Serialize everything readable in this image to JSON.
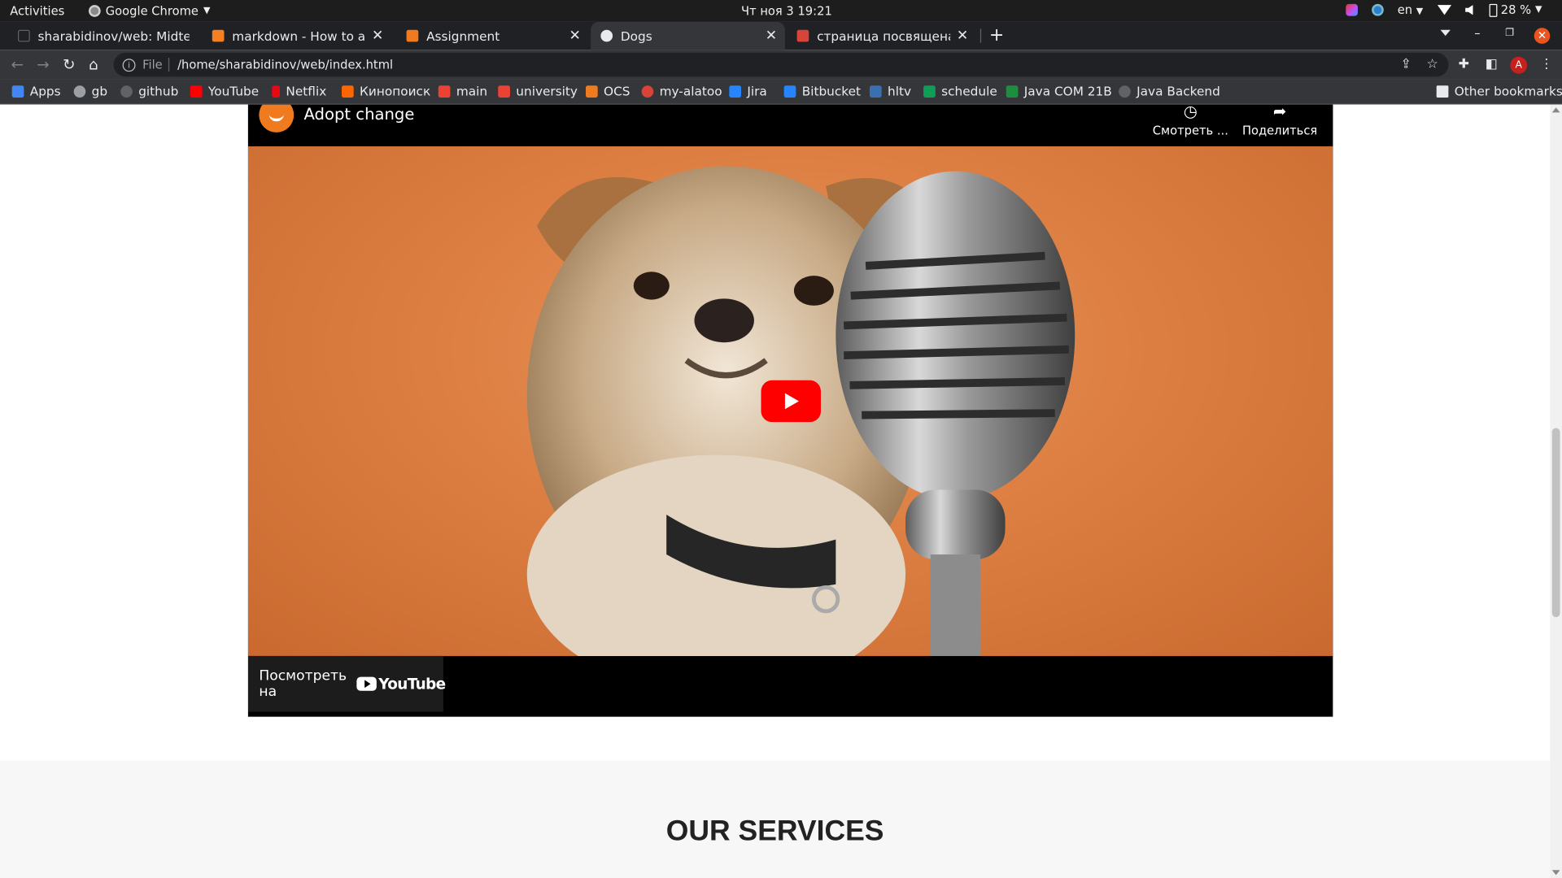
{
  "system_bar": {
    "activities": "Activities",
    "app_name": "Google Chrome",
    "clock": "Чт ноя 3  19:21",
    "keyboard_layout": "en",
    "battery": "28 %"
  },
  "tabs": [
    {
      "title": "sharabidinov/web: Midte",
      "favicon_color": "#202124",
      "active": false
    },
    {
      "title": "markdown - How to add in",
      "favicon_color": "#f48024",
      "active": false
    },
    {
      "title": "Assignment",
      "favicon_color": "#f07b1f",
      "active": false
    },
    {
      "title": "Dogs",
      "favicon_color": "#e8eaed",
      "active": true
    },
    {
      "title": "страница посвящена соб",
      "favicon_color": "#d9443a",
      "active": false
    }
  ],
  "toolbar": {
    "scheme": "File",
    "url": "/home/sharabidinov/web/index.html",
    "avatar_letter": "A"
  },
  "bookmarks": [
    {
      "label": "Apps",
      "icon": "apps-grid-icon",
      "color": "#4285f4"
    },
    {
      "label": "gb",
      "icon": "gb-icon",
      "color": "#9aa0a6"
    },
    {
      "label": "github",
      "icon": "github-icon",
      "color": "#5f6368"
    },
    {
      "label": "YouTube",
      "icon": "youtube-icon",
      "color": "#ff0000"
    },
    {
      "label": "Netflix",
      "icon": "netflix-icon",
      "color": "#e50914"
    },
    {
      "label": "Кинопоиск",
      "icon": "kinopoisk-icon",
      "color": "#ff6600"
    },
    {
      "label": "main",
      "icon": "gmail-icon",
      "color": "#ea4335"
    },
    {
      "label": "university",
      "icon": "gmail-icon",
      "color": "#ea4335"
    },
    {
      "label": "OCS",
      "icon": "ocs-icon",
      "color": "#f07b1f"
    },
    {
      "label": "my-alatoo",
      "icon": "alatoo-icon",
      "color": "#d9443a"
    },
    {
      "label": "Jira",
      "icon": "jira-icon",
      "color": "#2684ff"
    },
    {
      "label": "Bitbucket",
      "icon": "bitbucket-icon",
      "color": "#2684ff"
    },
    {
      "label": "hltv",
      "icon": "hltv-icon",
      "color": "#3a6fb0"
    },
    {
      "label": "schedule",
      "icon": "sheets-icon",
      "color": "#0f9d58"
    },
    {
      "label": "Java COM 21B",
      "icon": "classroom-icon",
      "color": "#1e8e3e"
    },
    {
      "label": "Java Backend",
      "icon": "github-icon",
      "color": "#5f6368"
    }
  ],
  "other_bookmarks": "Other bookmarks",
  "video": {
    "title": "Adopt change",
    "watch_later": "Смотреть ...",
    "share": "Поделиться",
    "watch_on": "Посмотреть на",
    "youtube_word": "YouTube"
  },
  "services": {
    "heading": "OUR SERVICES"
  }
}
